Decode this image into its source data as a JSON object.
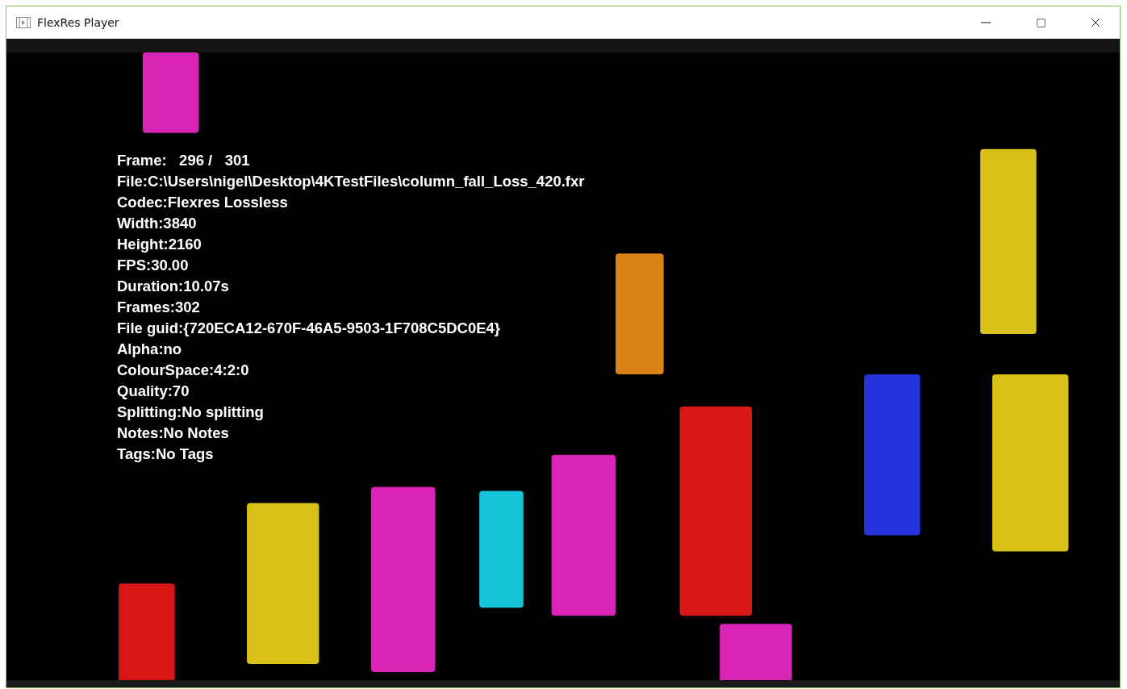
{
  "window": {
    "title": "FlexRes Player"
  },
  "overlay": {
    "lines": [
      "Frame:   296 /   301",
      "File:C:\\Users\\nigel\\Desktop\\4KTestFiles\\column_fall_Loss_420.fxr",
      "Codec:Flexres Lossless",
      "Width:3840",
      "Height:2160",
      "FPS:30.00",
      "Duration:10.07s",
      "Frames:302",
      "File guid:{720ECA12-670F-46A5-9503-1F708C5DC0E4}",
      "Alpha:no",
      "ColourSpace:4:2:0",
      "Quality:70",
      "Splitting:No splitting",
      "Notes:No Notes",
      "Tags:No Tags"
    ]
  }
}
